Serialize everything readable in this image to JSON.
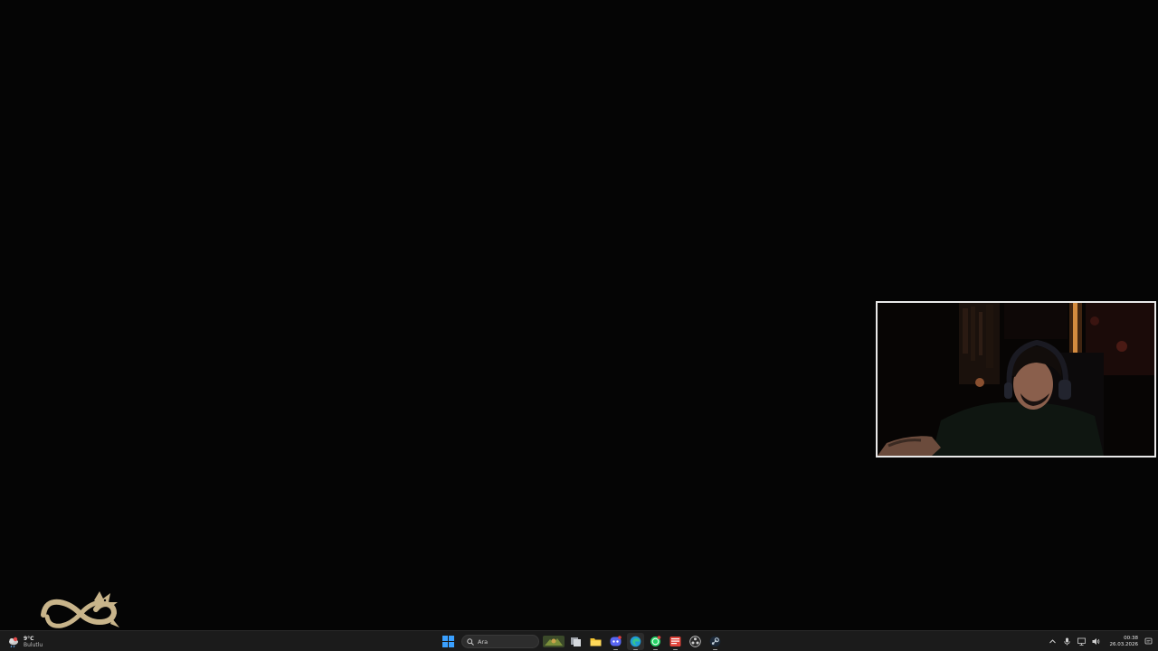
{
  "taskbar": {
    "weather": {
      "temperature": "9°C",
      "condition": "Bulutlu",
      "icon": "cloud-rain-icon"
    },
    "search": {
      "placeholder": "Ara"
    },
    "pinned_apps": [
      {
        "name": "start-button",
        "icon": "windows-logo-icon"
      },
      {
        "name": "search",
        "icon": "search-icon"
      },
      {
        "name": "widget-game-banner",
        "icon": "game-thumbnail-icon"
      },
      {
        "name": "task-view",
        "icon": "task-view-icon"
      },
      {
        "name": "file-explorer",
        "icon": "folder-icon"
      },
      {
        "name": "discord",
        "icon": "discord-icon"
      },
      {
        "name": "edge",
        "icon": "edge-icon"
      },
      {
        "name": "whatsapp",
        "icon": "whatsapp-icon"
      },
      {
        "name": "app-red",
        "icon": "red-app-icon"
      },
      {
        "name": "obs",
        "icon": "obs-icon"
      },
      {
        "name": "steam",
        "icon": "steam-icon"
      }
    ],
    "tray": {
      "clock_time": "00:38",
      "clock_date": "26.03.2026"
    }
  },
  "colors": {
    "desktop_bg": "#050505",
    "taskbar_bg": "#1b1b1b",
    "webcam_border": "#e9e9e9",
    "logo_gold": "#c8b48a"
  }
}
